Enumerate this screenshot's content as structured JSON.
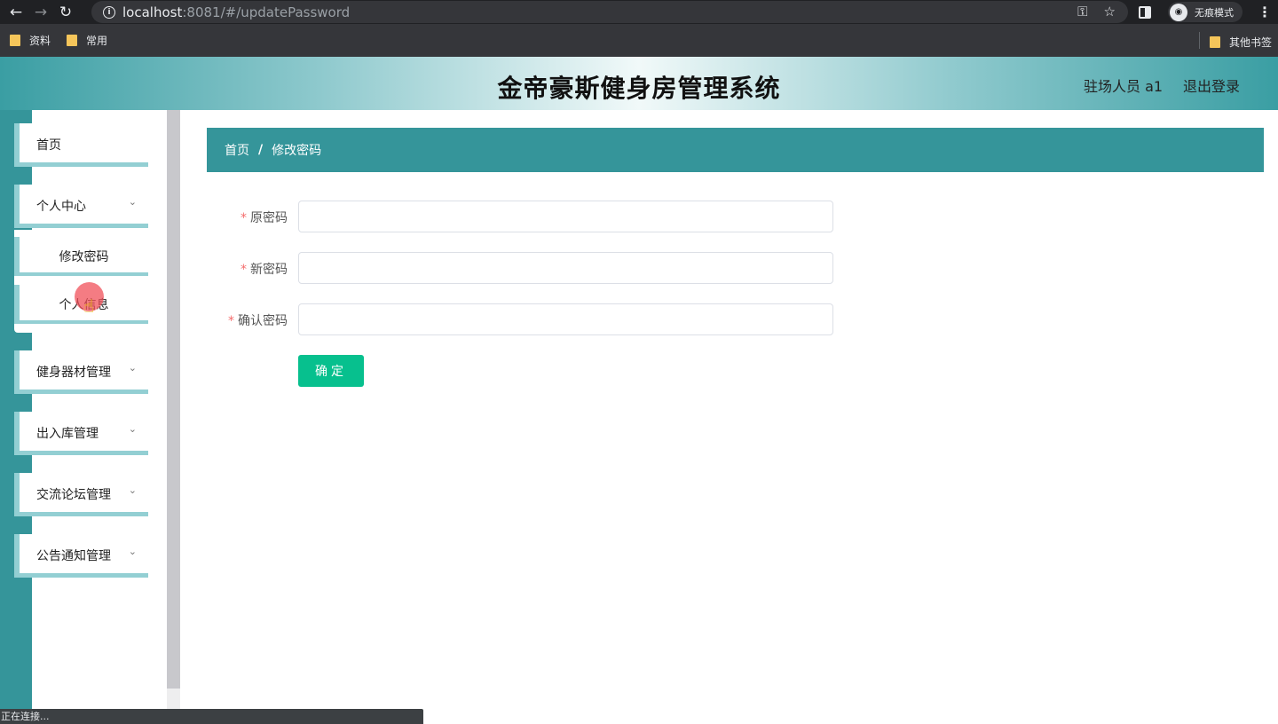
{
  "browser": {
    "url_host": "localhost",
    "url_path": ":8081/#/updatePassword",
    "incognito_label": "无痕模式",
    "status_text": "正在连接...",
    "bookmarks": [
      "资料",
      "常用"
    ],
    "other_bookmarks": "其他书签"
  },
  "header": {
    "title": "金帝豪斯健身房管理系统",
    "user_role": "驻场人员 a1",
    "logout": "退出登录"
  },
  "sidebar": {
    "home": "首页",
    "personal_center": "个人中心",
    "sub_change_password": "修改密码",
    "sub_personal_info": "个人信息",
    "equipment": "健身器材管理",
    "inventory": "出入库管理",
    "forum": "交流论坛管理",
    "notice": "公告通知管理"
  },
  "breadcrumb": {
    "home": "首页",
    "separator": "/",
    "current": "修改密码"
  },
  "form": {
    "required_mark": "*",
    "old_password_label": "原密码",
    "new_password_label": "新密码",
    "confirm_password_label": "确认密码",
    "old_password_value": "",
    "new_password_value": "",
    "confirm_password_value": "",
    "submit_label": "确定"
  }
}
